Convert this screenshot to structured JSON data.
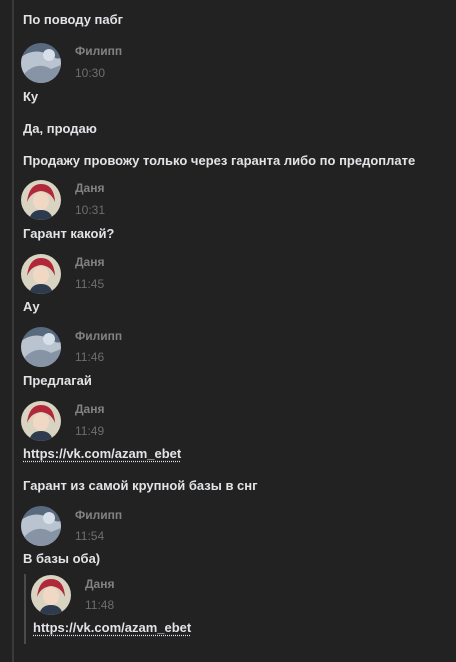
{
  "messages": [
    {
      "text": "По поводу пабг"
    },
    {
      "author": "Филипп",
      "time": "10:30",
      "avatar": "filipp-avatar"
    },
    {
      "text": "Ку"
    },
    {
      "text": "Да, продаю"
    },
    {
      "text": "Продажу провожу только через гаранта либо по предоплате"
    },
    {
      "author": "Даня",
      "time": "10:31",
      "avatar": "danya-avatar"
    },
    {
      "text": "Гарант какой?"
    },
    {
      "author": "Даня",
      "time": "11:45",
      "avatar": "danya-avatar"
    },
    {
      "text": "Ау"
    },
    {
      "author": "Филипп",
      "time": "11:46",
      "avatar": "filipp-avatar"
    },
    {
      "text": "Предлагай"
    },
    {
      "author": "Даня",
      "time": "11:49",
      "avatar": "danya-avatar"
    },
    {
      "text": "https://vk.com/azam_ebet"
    },
    {
      "text": "Гарант из самой крупной базы в снг"
    },
    {
      "author": "Филипп",
      "time": "11:54",
      "avatar": "filipp-avatar"
    },
    {
      "text": "В базы оба)"
    }
  ],
  "forwarded": {
    "author": "Даня",
    "time": "11:48",
    "text": "https://vk.com/azam_ebet"
  },
  "colors": {
    "background": "#222222",
    "text": "#e1e3e6",
    "author": "#828282",
    "time": "#6e6e6e"
  }
}
